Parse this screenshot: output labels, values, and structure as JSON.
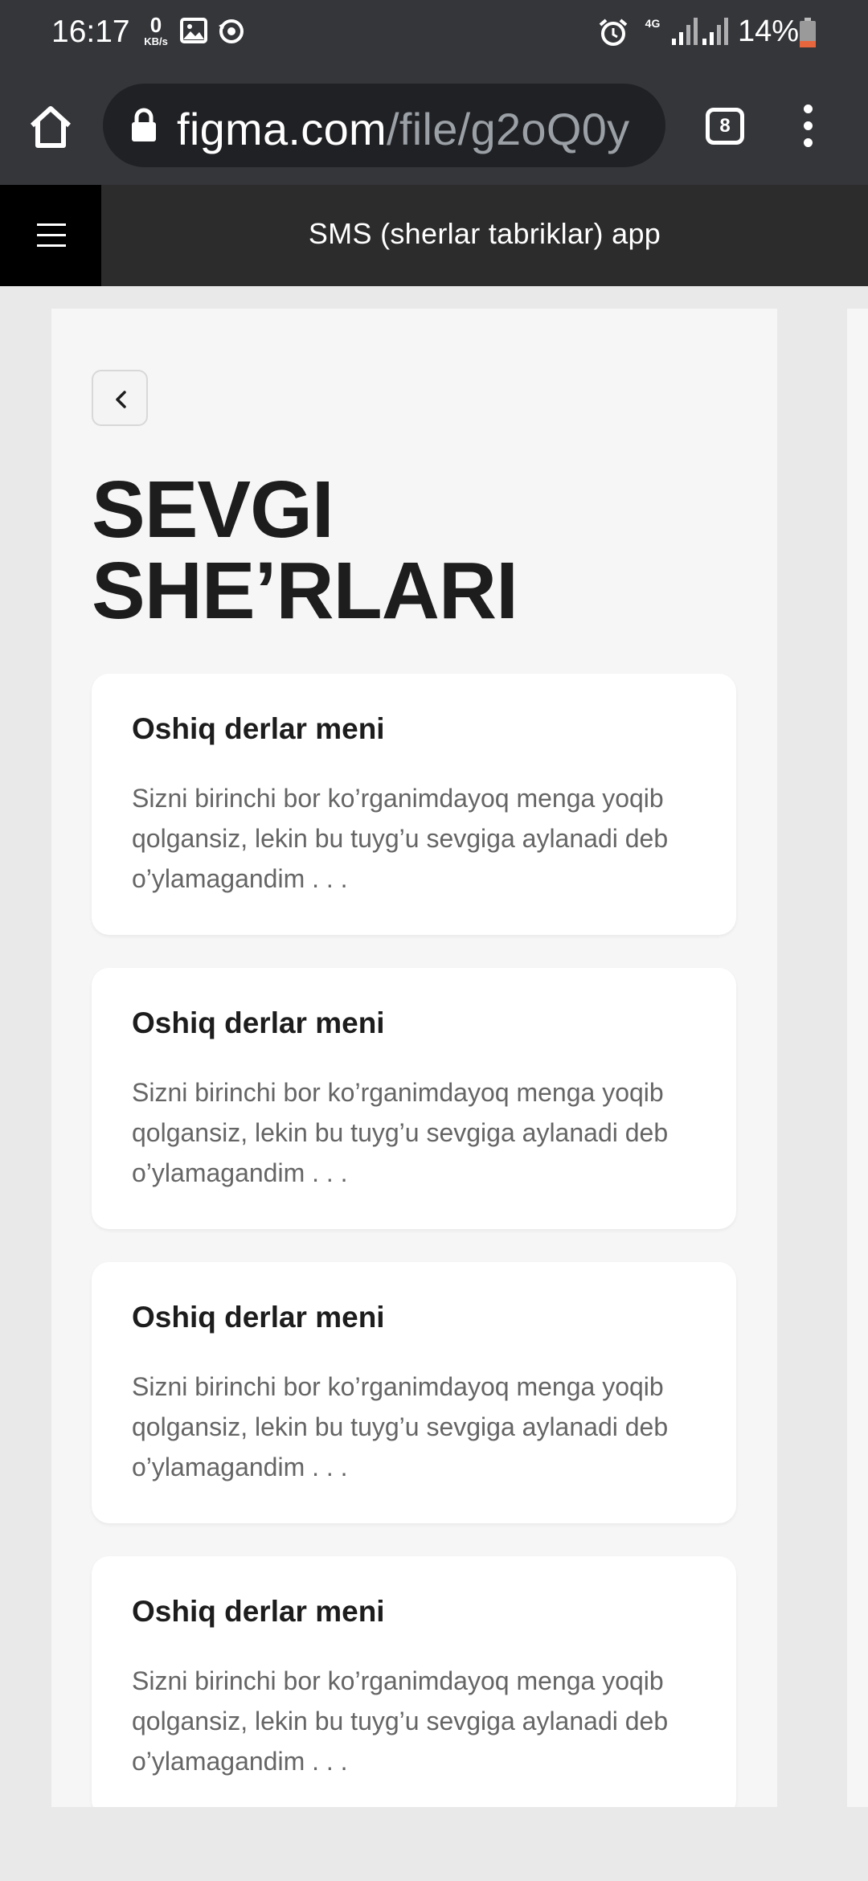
{
  "status_bar": {
    "time": "16:17",
    "net_speed_value": "0",
    "net_speed_unit": "KB/s",
    "network_type": "4G",
    "battery_percent": "14%"
  },
  "browser": {
    "url_host": "figma.com",
    "url_path": "/file/g2oQ0y",
    "tab_count": "8"
  },
  "figma": {
    "file_title": "SMS (sherlar tabriklar) app"
  },
  "page": {
    "title_line1": "SEVGI",
    "title_line2": "SHE’RLARI",
    "cards": [
      {
        "title": "Oshiq derlar meni",
        "excerpt": "Sizni birinchi bor ko’rganimdayoq menga yoqib qolgansiz, lekin bu tuyg’u sevgiga aylanadi deb o’ylamagandim . . ."
      },
      {
        "title": "Oshiq derlar meni",
        "excerpt": "Sizni birinchi bor ko’rganimdayoq menga yoqib qolgansiz, lekin bu tuyg’u sevgiga aylanadi deb o’ylamagandim . . ."
      },
      {
        "title": "Oshiq derlar meni",
        "excerpt": "Sizni birinchi bor ko’rganimdayoq menga yoqib qolgansiz, lekin bu tuyg’u sevgiga aylanadi deb o’ylamagandim . . ."
      },
      {
        "title": "Oshiq derlar meni",
        "excerpt": "Sizni birinchi bor ko’rganimdayoq menga yoqib qolgansiz, lekin bu tuyg’u sevgiga aylanadi deb o’ylamagandim . . ."
      }
    ]
  },
  "icons": {
    "status": [
      "image-icon",
      "sync-icon",
      "alarm-icon",
      "signal-icon",
      "signal-icon",
      "battery-icon"
    ],
    "browser": [
      "home-icon",
      "lock-icon",
      "tabs-icon",
      "more-vertical-icon"
    ],
    "figma": [
      "hamburger-menu-icon"
    ],
    "page": [
      "chevron-left-icon"
    ]
  },
  "colors": {
    "chrome_dark": "#35363a",
    "url_pill": "#202124",
    "figma_header": "#2c2c2c",
    "canvas": "#e9e9e9",
    "frame_bg": "#f6f6f6",
    "title_text": "#1d1d1d",
    "body_text": "#656565",
    "battery_low": "#e8663d"
  }
}
